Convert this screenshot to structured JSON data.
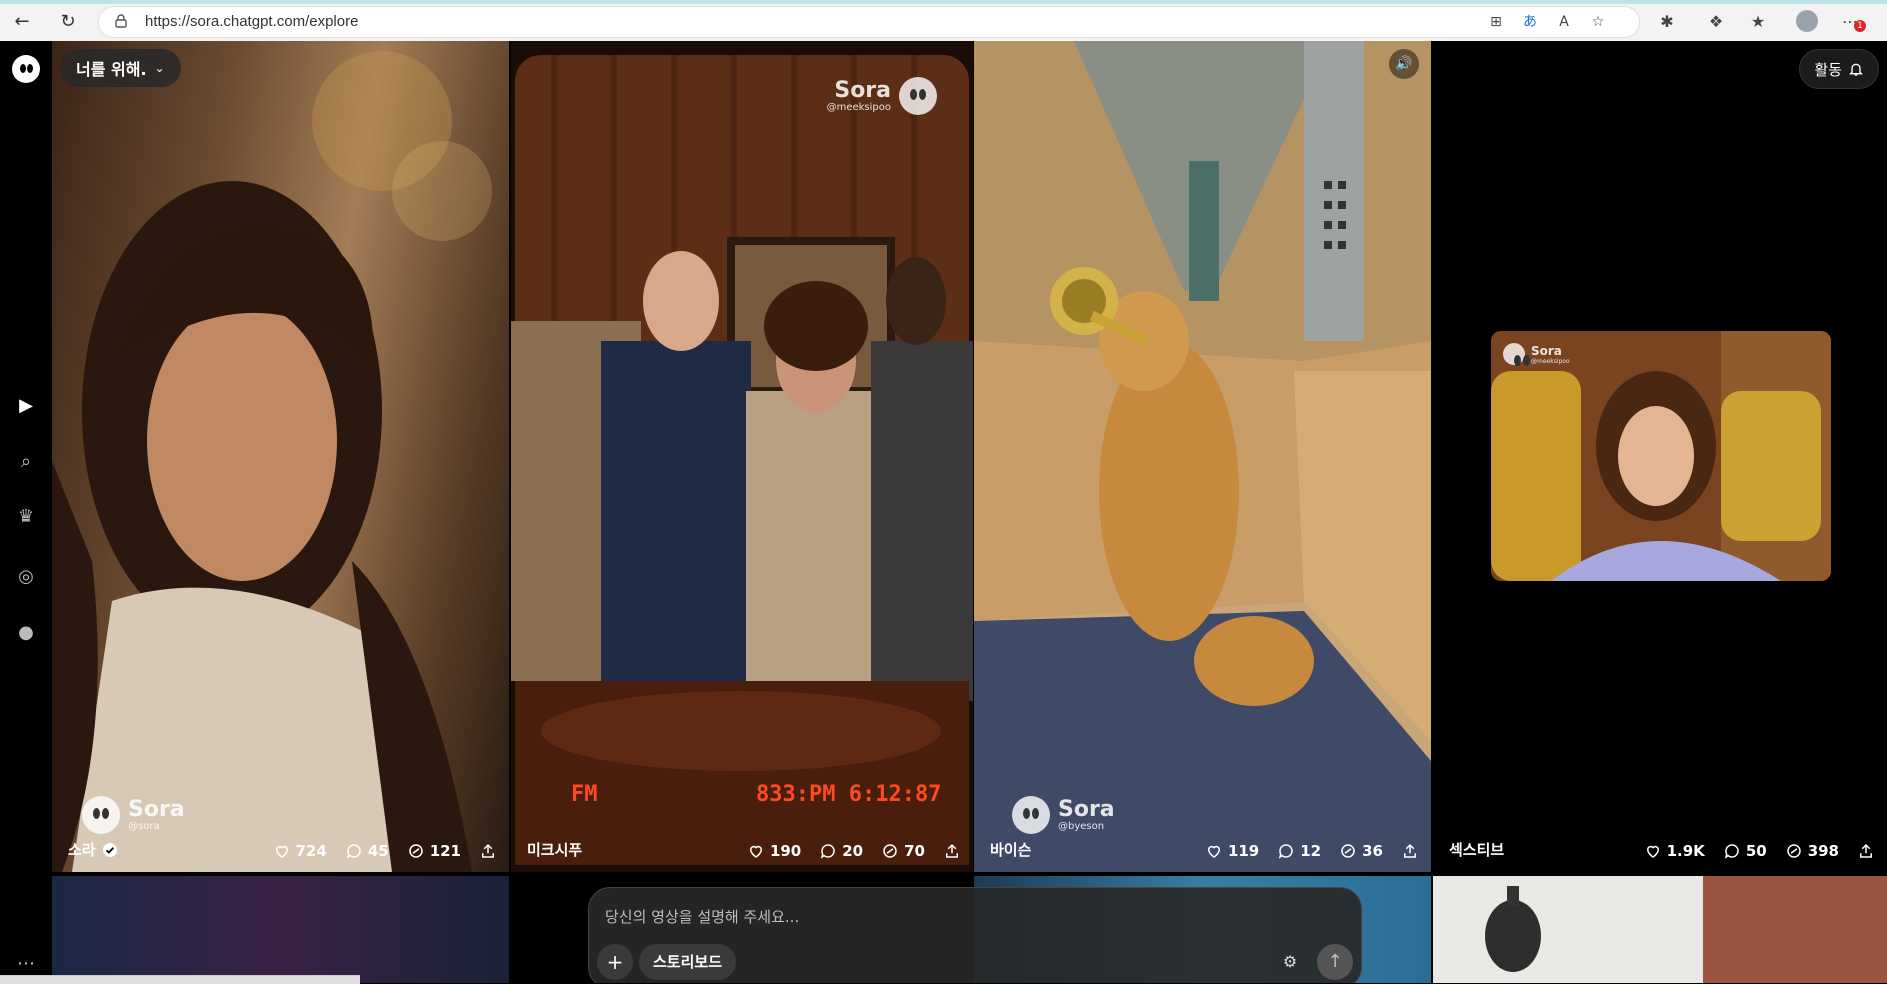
{
  "browser": {
    "url": "https://sora.chatgpt.com/explore",
    "badge_count": "1"
  },
  "header": {
    "feed_selector": "너를 위해.",
    "activity_label": "활동"
  },
  "tiles": [
    {
      "author": "소라",
      "verified": true,
      "likes": "724",
      "comments": "45",
      "remixes": "121",
      "watermark_name": "Sora",
      "watermark_handle": "@sora"
    },
    {
      "author": "미크시푸",
      "verified": false,
      "likes": "190",
      "comments": "20",
      "remixes": "70",
      "watermark_name": "Sora",
      "watermark_handle": "@meeksipoo",
      "overlay_left": "FM",
      "overlay_right": "833:PM 6:12:87"
    },
    {
      "author": "바이슨",
      "verified": false,
      "likes": "119",
      "comments": "12",
      "remixes": "36",
      "watermark_name": "Sora",
      "watermark_handle": "@byeson"
    },
    {
      "author": "섹스티브",
      "verified": false,
      "likes": "1.9K",
      "comments": "50",
      "remixes": "398",
      "watermark_name": "Sora",
      "watermark_handle": "@meeksipoo"
    }
  ],
  "prompt": {
    "placeholder": "당신의 영상을 설명해 주세요...",
    "storyboard_label": "스토리보드"
  },
  "colors": {
    "accent": "#ffffff",
    "background": "#000000"
  }
}
